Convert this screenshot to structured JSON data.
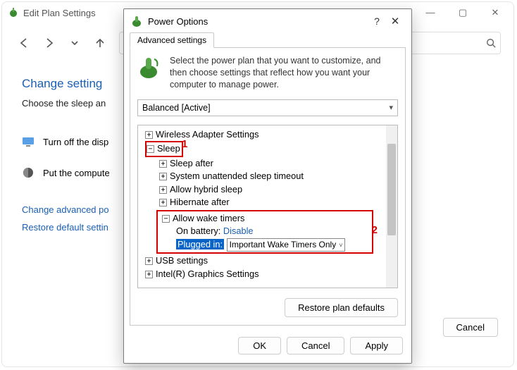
{
  "parent": {
    "title": "Edit Plan Settings",
    "heading_partial": "Change setting",
    "subtext_partial": "Choose the sleep an",
    "row1_partial": "Turn off the disp",
    "row2_partial": "Put the compute",
    "link1_partial": "Change advanced po",
    "link2_partial": "Restore default settin",
    "cancel_btn": "Cancel"
  },
  "dialog": {
    "title": "Power Options",
    "tab": "Advanced settings",
    "intro": "Select the power plan that you want to customize, and then choose settings that reflect how you want your computer to manage power.",
    "plan_selected": "Balanced [Active]",
    "tree": {
      "n0": "Wireless Adapter Settings",
      "n1_sleep": "Sleep",
      "n1a": "Sleep after",
      "n1b": "System unattended sleep timeout",
      "n1c": "Allow hybrid sleep",
      "n1d": "Hibernate after",
      "n1e": "Allow wake timers",
      "n1e_batt_label": "On battery:",
      "n1e_batt_value": "Disable",
      "n1e_plug_label": "Plugged in:",
      "n1e_plug_value": "Important Wake Timers Only",
      "n2": "USB settings",
      "n3": "Intel(R) Graphics Settings"
    },
    "restore_btn": "Restore plan defaults",
    "ok_btn": "OK",
    "cancel_btn": "Cancel",
    "apply_btn": "Apply"
  },
  "annotations": {
    "a1": "1",
    "a2": "2"
  }
}
